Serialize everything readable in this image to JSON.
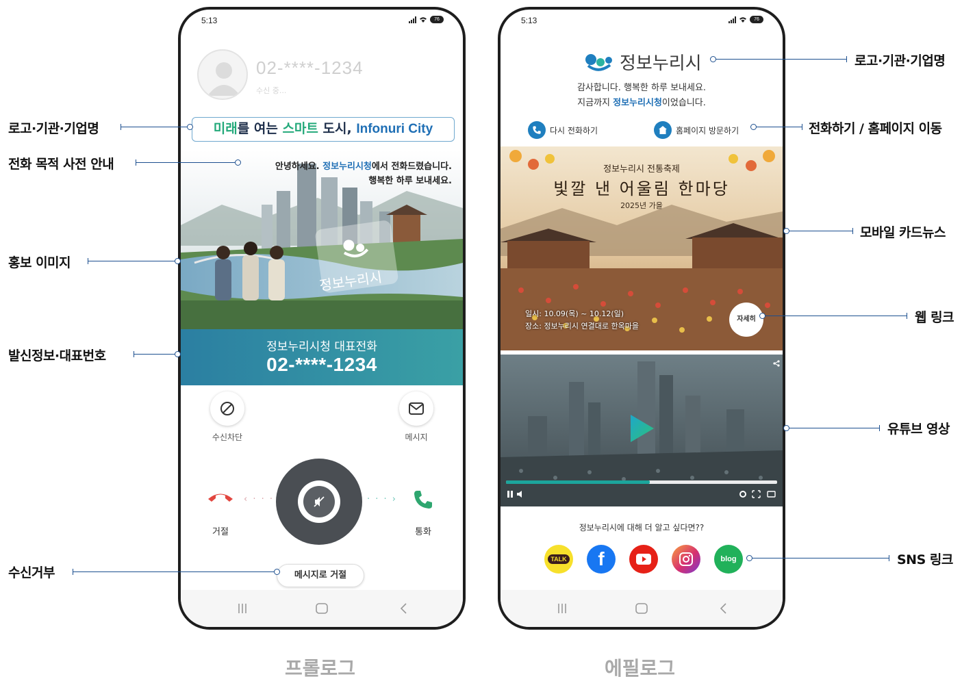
{
  "status_bar": {
    "time": "5:13",
    "battery": "76"
  },
  "prologue": {
    "caller_number": "02-****-1234",
    "caller_status": "수신 중...",
    "slogan": {
      "part1": "미래",
      "part2": "를 여는 ",
      "part3": "스마트",
      "part4": " 도시, ",
      "part5": "Infonuri City"
    },
    "greeting": {
      "pre": "안녕하세요. ",
      "org": "정보누리시청",
      "post": "에서 전화드렸습니다.",
      "line2": "행복한 하루 보내세요."
    },
    "promo_logo_text": "정보누리시",
    "banner": {
      "name": "정보누리시청 대표전화",
      "number": "02-****-1234"
    },
    "block_label": "수신차단",
    "message_label": "메시지",
    "reject_label": "거절",
    "accept_label": "통화",
    "reject_message_button": "메시지로 거절"
  },
  "epilogue": {
    "logo_text": "정보누리시",
    "thanks_line1": "감사합니다. 행복한 하루 보내세요.",
    "thanks_pre": "지금까지 ",
    "thanks_org": "정보누리시청",
    "thanks_post": "이었습니다.",
    "call_again": "다시 전화하기",
    "visit_homepage": "홈페이지 방문하기",
    "card": {
      "subtitle": "정보누리시 전통축제",
      "title": "빛깔 낸 어울림 한마당",
      "season": "2025년 가을",
      "info_line1": "일시: 10.09(목) ~ 10.12(일)",
      "info_line2": "장소: 정보누리시 연결대로 한옥마을",
      "detail_button": "자세히"
    },
    "video": {
      "progress": 0.53
    },
    "sns_question": "정보누리시에 대해 더 알고 싶다면??",
    "sns": [
      {
        "name": "kakaotalk",
        "label": "TALK",
        "color": "#f7e02b"
      },
      {
        "name": "facebook",
        "label": "f",
        "color": "#1877f2"
      },
      {
        "name": "youtube",
        "label": "",
        "color": "#e62117"
      },
      {
        "name": "instagram",
        "label": "",
        "color": "#d6306f"
      },
      {
        "name": "naver-blog",
        "label": "blog",
        "color": "#21b15a"
      }
    ]
  },
  "annotations_left": {
    "logo": "로고·기관·기업명",
    "purpose": "전화 목적 사전 안내",
    "promo": "홍보 이미지",
    "caller_info": "발신정보·대표번호",
    "reject": "수신거부"
  },
  "annotations_right": {
    "logo": "로고·기관·기업명",
    "call_home": "전화하기 / 홈페이지 이동",
    "card_news": "모바일 카드뉴스",
    "web_link": "웹 링크",
    "youtube": "유튜브 영상",
    "sns": "SNS 링크"
  },
  "captions": {
    "left": "프롤로그",
    "right": "에필로그"
  },
  "colors": {
    "accent": "#1c4f8f",
    "brand_blue": "#1f6fb5",
    "brand_green": "#23a97a",
    "teal": "#2f93a4"
  }
}
